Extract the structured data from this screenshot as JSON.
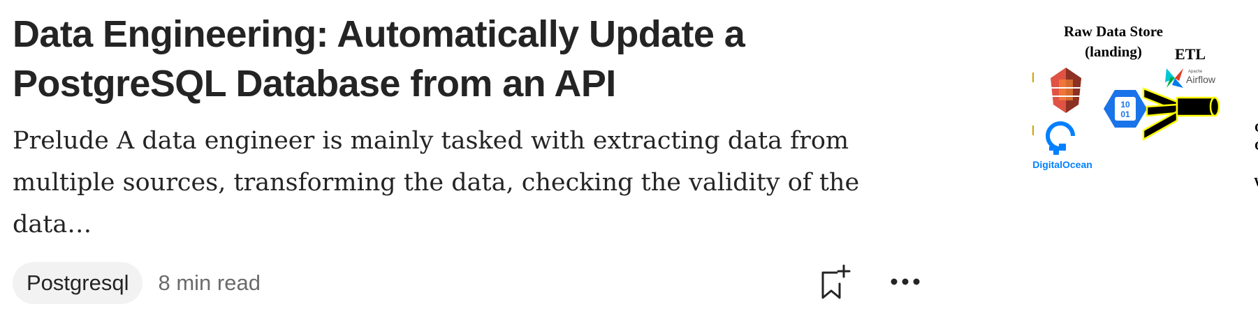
{
  "article": {
    "title": "Data Engineering: Automatically Update a PostgreSQL Database from an API",
    "excerpt": "Prelude A data engineer is mainly tasked with extracting data from\nmultiple sources, transforming the data, checking the validity of the data…",
    "tag": "Postgresql",
    "read_time": "8 min read"
  },
  "actions": {
    "save_icon": "bookmark-add-icon",
    "more_icon": "more-horizontal-icon"
  },
  "thumbnail": {
    "raw_data_store_label": "Raw Data Store",
    "landing_label": "(landing)",
    "etl_label": "ETL",
    "apache_label": "Apache",
    "airflow_label": "Airflow",
    "digitalocean_label": "DigitalOcean",
    "binary_label_top": "10",
    "binary_label_bottom": "01",
    "cropped_char_1": "C",
    "cropped_char_2": "C",
    "cropped_char_3": "W"
  },
  "colors": {
    "text_primary": "#242424",
    "text_secondary": "#6b6b6b",
    "tag_background": "#f2f2f2",
    "s3_red": "#e05243",
    "digitalocean_blue": "#0080ff",
    "hex_blue": "#1a73e8",
    "pipe_yellow": "#ffff00"
  }
}
